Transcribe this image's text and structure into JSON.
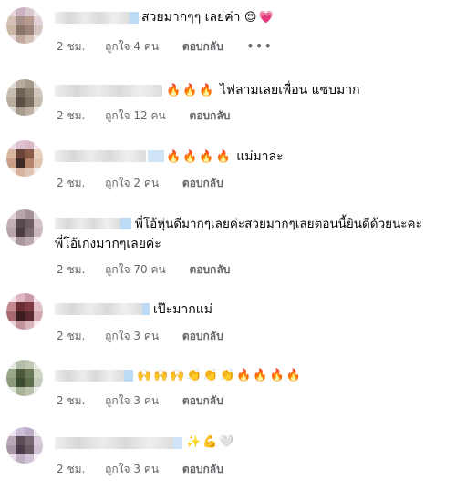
{
  "comments": [
    {
      "text": "สวยมากๆๆ เลยค่า",
      "emojis": [
        "😍",
        "💗"
      ],
      "time": "2 ชม.",
      "likes": "ถูกใจ 4 คน",
      "reply": "ตอบกลับ",
      "more": "•••"
    },
    {
      "emojis": [
        "🔥",
        "🔥",
        "🔥"
      ],
      "text": "ไฟลามเลยเพื่อน แซบมาก",
      "time": "2 ชม.",
      "likes": "ถูกใจ 12 คน",
      "reply": "ตอบกลับ"
    },
    {
      "emojis": [
        "🔥",
        "🔥",
        "🔥",
        "🔥"
      ],
      "text": "แม่มาล่ะ",
      "time": "2 ชม.",
      "likes": "ถูกใจ 2 คน",
      "reply": "ตอบกลับ"
    },
    {
      "text": "พี่โอ้หุ่นดีมากๆเลยค่ะสวยมากๆเลยตอนนี้ยินดีด้วยนะคะ",
      "text2": "พี่โอ้เก่งมากๆเลยค่ะ",
      "time": "2 ชม.",
      "likes": "ถูกใจ 70 คน",
      "reply": "ตอบกลับ"
    },
    {
      "text": "เป๊ะมากแม่",
      "time": "2 ชม.",
      "likes": "ถูกใจ 3 คน",
      "reply": "ตอบกลับ"
    },
    {
      "emojis": [
        "🙌",
        "🙌",
        "🙌",
        "👏",
        "👏",
        "👏",
        "🔥",
        "🔥",
        "🔥",
        "🔥"
      ],
      "time": "2 ชม.",
      "likes": "ถูกใจ 3 คน",
      "reply": "ตอบกลับ"
    },
    {
      "emojis": [
        "✨",
        "💪",
        "🤍"
      ],
      "time": "2 ชม.",
      "likes": "ถูกใจ 3 คน",
      "reply": "ตอบกลับ"
    }
  ]
}
